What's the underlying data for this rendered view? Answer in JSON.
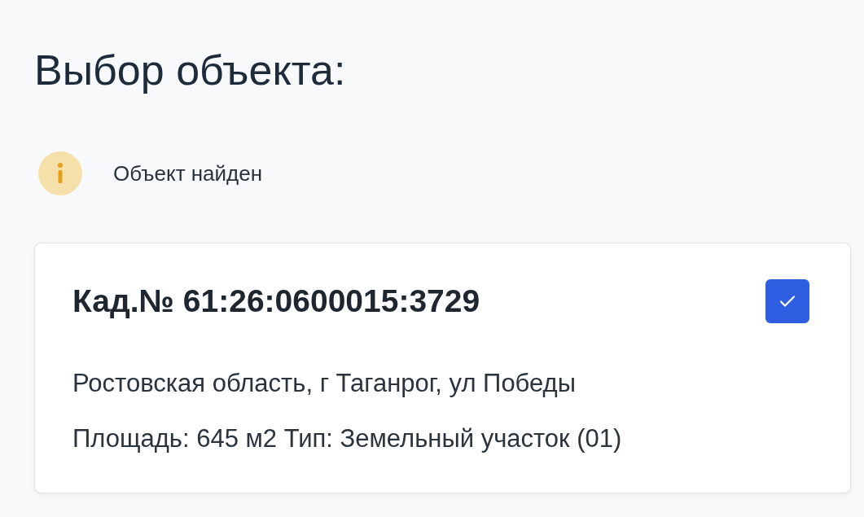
{
  "title": "Выбор объекта:",
  "notice": {
    "text": "Объект найден"
  },
  "object": {
    "heading": "Кад.№ 61:26:0600015:3729",
    "checked": true,
    "lines": [
      "Ростовская область, г Таганрог, ул Победы",
      "Площадь: 645 м2 Тип: Земельный участок (01)"
    ]
  }
}
